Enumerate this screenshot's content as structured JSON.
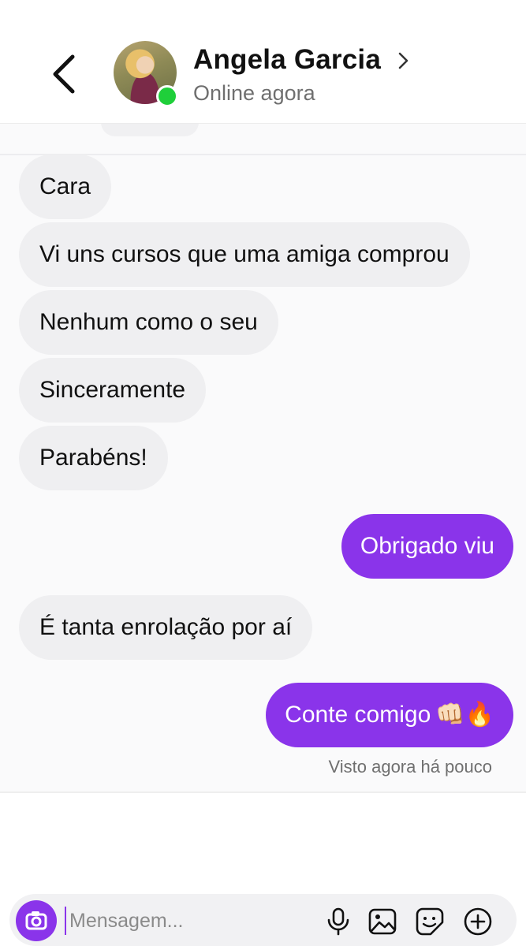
{
  "header": {
    "contact_name": "Angela Garcia",
    "status": "Online agora"
  },
  "messages": [
    {
      "direction": "in",
      "text": "Cara"
    },
    {
      "direction": "in",
      "text": "Vi uns cursos que uma amiga comprou"
    },
    {
      "direction": "in",
      "text": "Nenhum como o seu"
    },
    {
      "direction": "in",
      "text": "Sinceramente"
    },
    {
      "direction": "in",
      "text": "Parabéns!"
    },
    {
      "direction": "out",
      "text": "Obrigado viu"
    },
    {
      "direction": "in",
      "text": "É tanta enrolação por aí"
    },
    {
      "direction": "out",
      "text": "Conte comigo",
      "emojis": "👊🏻🔥"
    }
  ],
  "read_receipt": "Visto agora há pouco",
  "composer": {
    "placeholder": "Mensagem...",
    "icons": [
      "camera-icon",
      "microphone-icon",
      "gallery-icon",
      "sticker-icon",
      "add-icon"
    ]
  },
  "colors": {
    "accent": "#8a34ea",
    "incoming_bubble": "#efeff1",
    "online": "#1fcf3a"
  }
}
